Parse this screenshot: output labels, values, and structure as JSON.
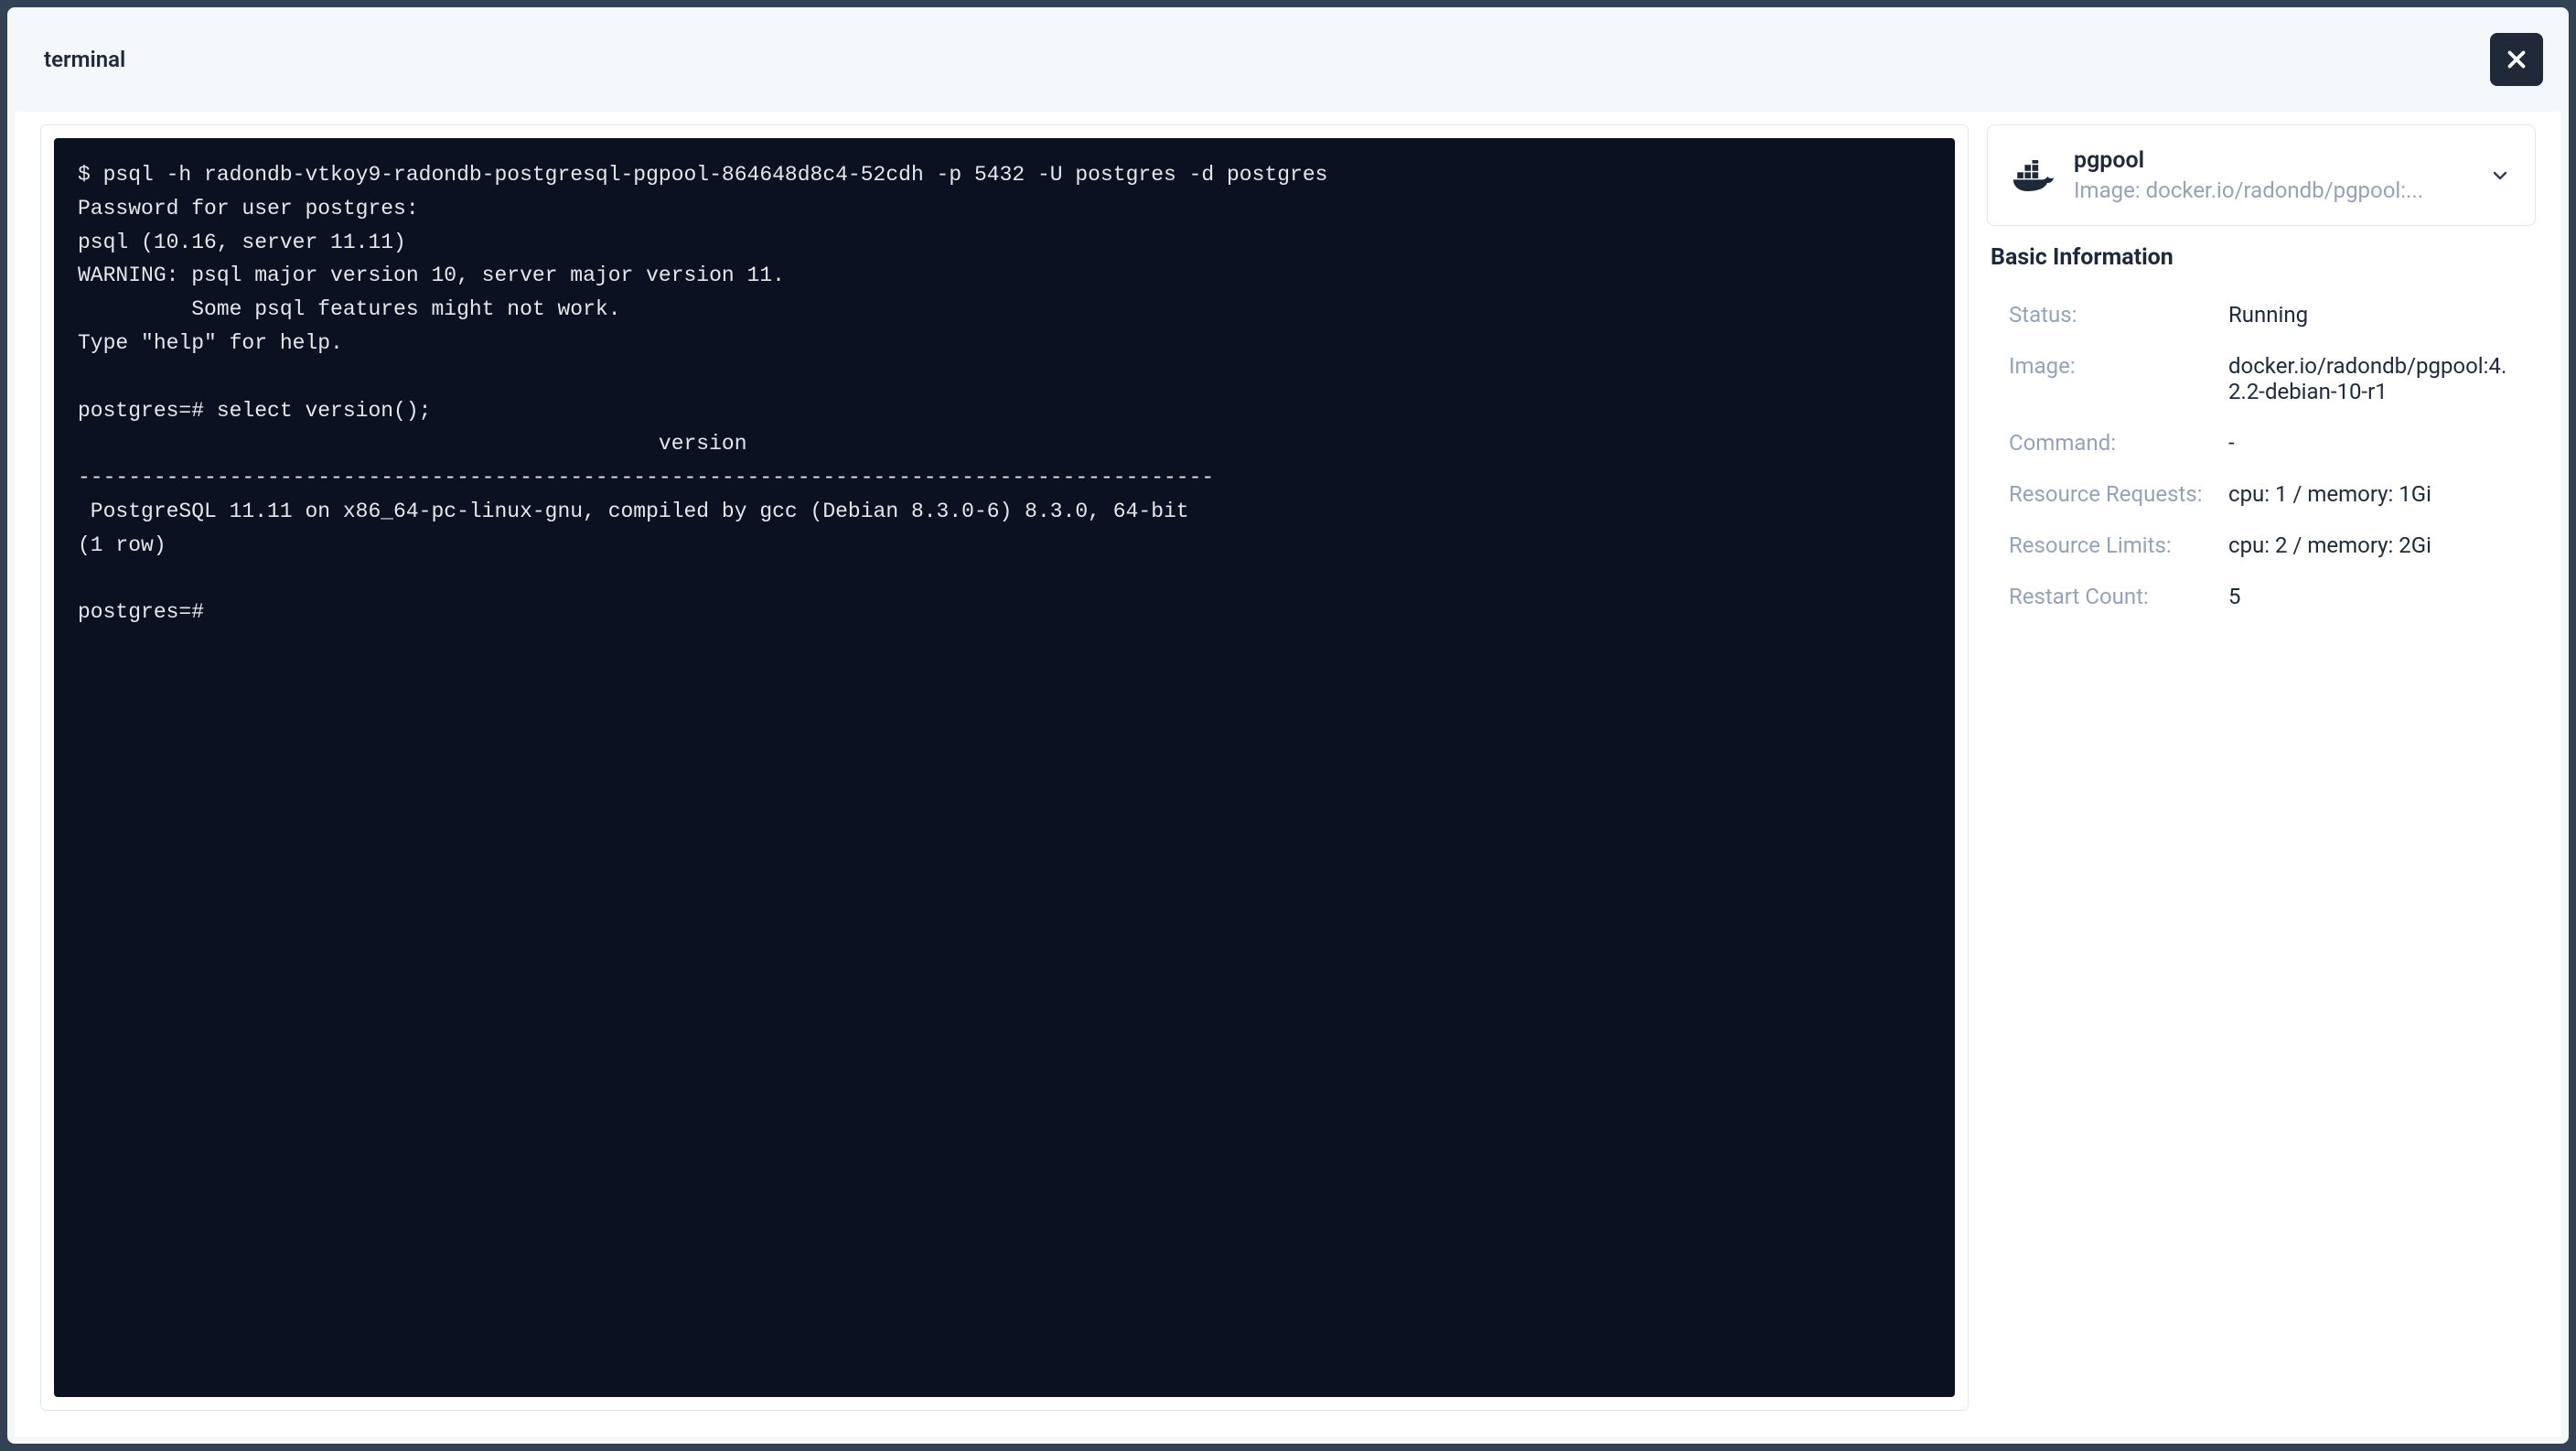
{
  "header": {
    "title": "terminal"
  },
  "terminal": {
    "output": "$ psql -h radondb-vtkoy9-radondb-postgresql-pgpool-864648d8c4-52cdh -p 5432 -U postgres -d postgres\nPassword for user postgres:\npsql (10.16, server 11.11)\nWARNING: psql major version 10, server major version 11.\n         Some psql features might not work.\nType \"help\" for help.\n\npostgres=# select version();\n                                              version\n------------------------------------------------------------------------------------------\n PostgreSQL 11.11 on x86_64-pc-linux-gnu, compiled by gcc (Debian 8.3.0-6) 8.3.0, 64-bit\n(1 row)\n\npostgres=#"
  },
  "container": {
    "name": "pgpool",
    "image_line": "Image: docker.io/radondb/pgpool:..."
  },
  "basic_info": {
    "section_title": "Basic Information",
    "rows": [
      {
        "label": "Status:",
        "value": "Running"
      },
      {
        "label": "Image:",
        "value": "docker.io/radondb/pgpool:4.2.2-debian-10-r1"
      },
      {
        "label": "Command:",
        "value": "-"
      },
      {
        "label": "Resource Requests:",
        "value": "cpu: 1 / memory: 1Gi"
      },
      {
        "label": "Resource Limits:",
        "value": "cpu: 2 / memory: 2Gi"
      },
      {
        "label": "Restart Count:",
        "value": "5"
      }
    ]
  }
}
